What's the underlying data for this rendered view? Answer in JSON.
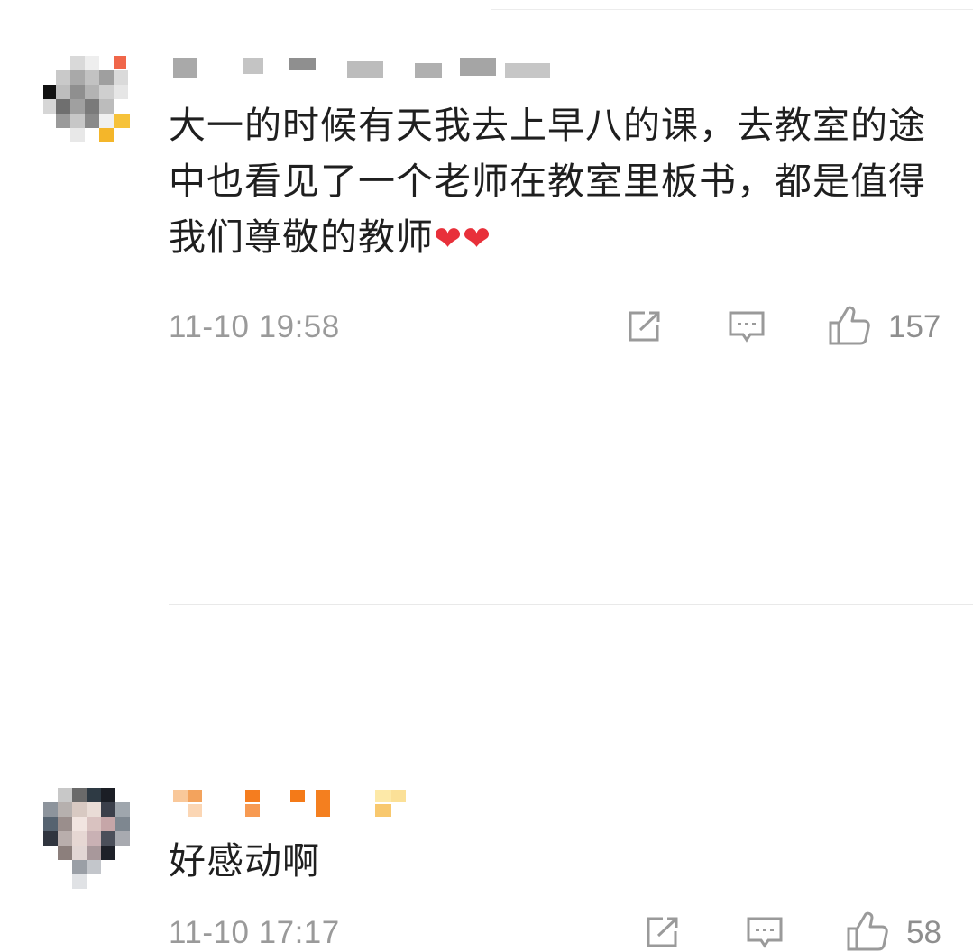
{
  "comments": [
    {
      "username": "",
      "text": "大一的时候有天我去上早八的课，去教室的途中也看见了一个老师在教室里板书，都是值得我们尊敬的教师",
      "emoji": "❤❤",
      "time": "11-10 19:58",
      "likes": "157"
    },
    {
      "username": "",
      "text": "好感动啊",
      "emoji": "",
      "time": "11-10 17:17",
      "likes": "58"
    }
  ],
  "icons": {
    "repost": "share-square-icon",
    "comment": "comment-bubble-icon",
    "like": "thumbs-up-icon"
  },
  "colors": {
    "text": "#1f1f1f",
    "meta": "#9a9a9a",
    "heart": "#e8303a",
    "username_blur_1": "#b8b8b8",
    "username_blur_2": "#f38a2e"
  }
}
